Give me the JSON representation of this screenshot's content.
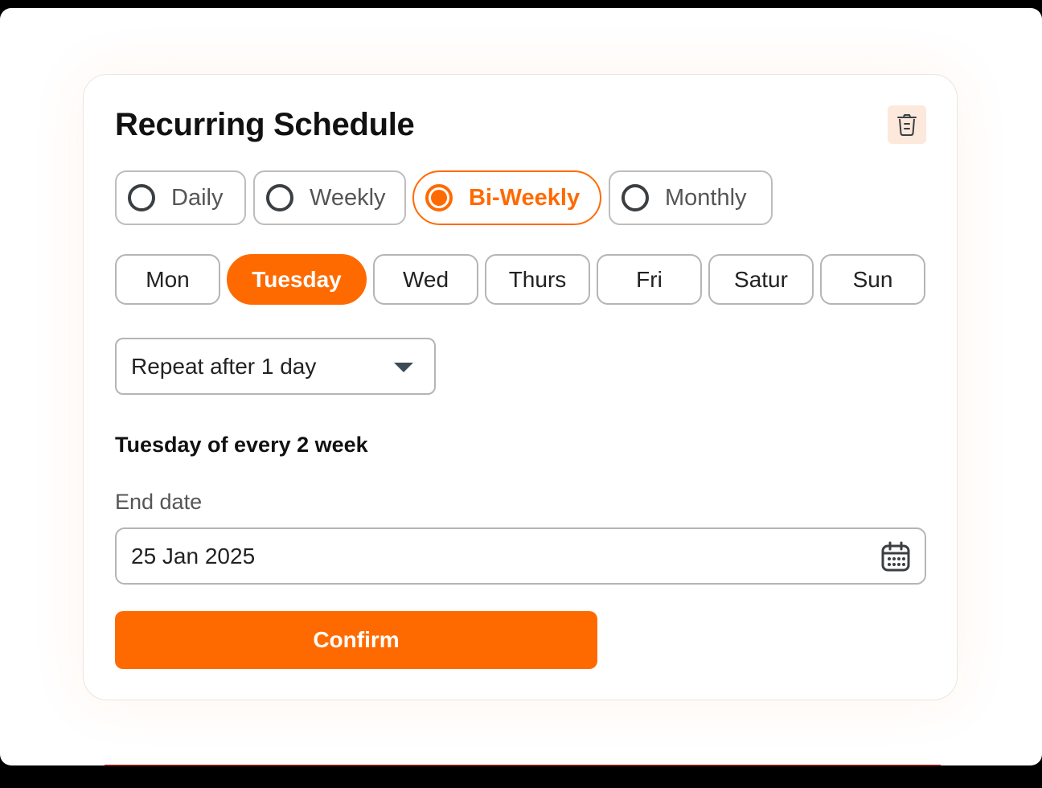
{
  "card": {
    "title": "Recurring Schedule",
    "delete_icon": "trash-icon"
  },
  "frequency": {
    "options": [
      {
        "label": "Daily",
        "selected": false
      },
      {
        "label": "Weekly",
        "selected": false
      },
      {
        "label": "Bi-Weekly",
        "selected": true
      },
      {
        "label": "Monthly",
        "selected": false
      }
    ]
  },
  "days": [
    {
      "label": "Mon",
      "selected": false
    },
    {
      "label": "Tuesday",
      "selected": true
    },
    {
      "label": "Wed",
      "selected": false
    },
    {
      "label": "Thurs",
      "selected": false
    },
    {
      "label": "Fri",
      "selected": false
    },
    {
      "label": "Satur",
      "selected": false
    },
    {
      "label": "Sun",
      "selected": false
    }
  ],
  "repeat": {
    "value": "Repeat after 1 day",
    "icon": "chevron-down-icon"
  },
  "summary": "Tuesday of every 2 week",
  "end_date": {
    "label": "End date",
    "value": "25 Jan 2025",
    "icon": "calendar-icon"
  },
  "confirm_label": "Confirm",
  "colors": {
    "accent": "#ff6a00",
    "delete_bg": "#fde8dc",
    "border": "#b5b5b5",
    "text": "#111111"
  }
}
